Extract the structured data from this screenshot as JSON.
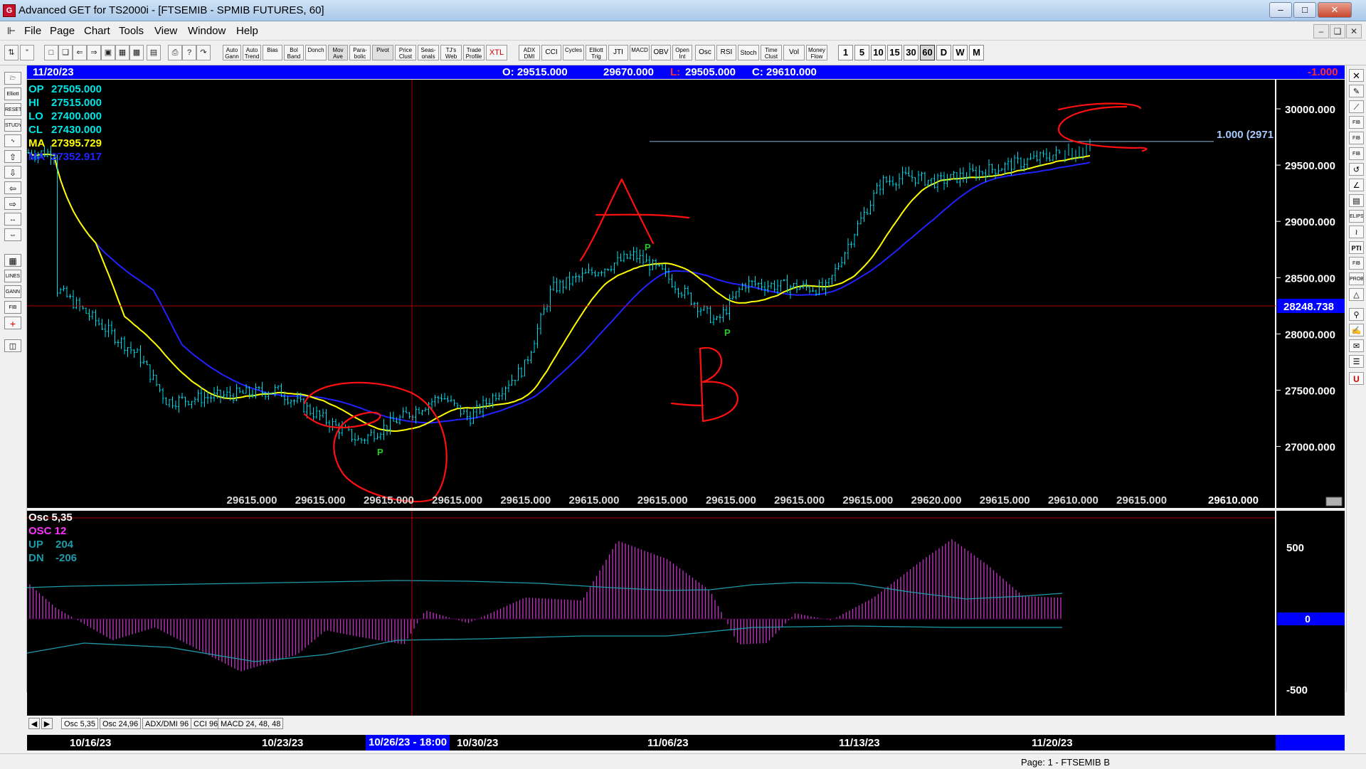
{
  "window": {
    "title": "Advanced GET for TS2000i - [FTSEMIB - SPMIB FUTURES, 60]"
  },
  "menu": [
    "File",
    "Page",
    "Chart",
    "Tools",
    "View",
    "Window",
    "Help"
  ],
  "toolbar": {
    "studies": [
      "Auto Gann",
      "Auto Trend",
      "Bias",
      "Bol Band",
      "Donch",
      "Mov Ave",
      "Para-bolic",
      "Pivot",
      "Price Clust",
      "Seas-onals",
      "TJ's Web",
      "Trade Profile",
      "XTL",
      "ADX DMI",
      "CCI",
      "Cycles",
      "Elliott Trig",
      "JTI",
      "MACD",
      "OBV",
      "Open Int",
      "Osc",
      "RSI",
      "Stoch",
      "Time Clust",
      "Vol",
      "Money Flow"
    ],
    "timeframes": [
      "1",
      "5",
      "10",
      "15",
      "30",
      "60",
      "D",
      "W",
      "M"
    ],
    "active_timeframe": "60"
  },
  "left_tools": [
    "Elliott",
    "RESET",
    "STUDY",
    "LINES",
    "GANN",
    "FIB"
  ],
  "right_tools": [
    "FIB RET",
    "FIB EXT",
    "FIB TIME",
    "ELIPS",
    "PTI",
    "FIB",
    "PROB",
    "U"
  ],
  "info_bar": {
    "date": "11/20/23",
    "open": "O: 29515.000",
    "high": "29670.000",
    "low_label": "L:",
    "low": "29505.000",
    "close": "C: 29610.000",
    "change": "-1.000"
  },
  "legend": [
    {
      "label": "OP",
      "value": "27505.000",
      "color": "#00e5e5"
    },
    {
      "label": "HI",
      "value": "27515.000",
      "color": "#00e5e5"
    },
    {
      "label": "LO",
      "value": "27400.000",
      "color": "#00e5e5"
    },
    {
      "label": "CL",
      "value": "27430.000",
      "color": "#00e5e5"
    },
    {
      "label": "MA",
      "value": "27395.729",
      "color": "#ffff00"
    },
    {
      "label": "MA",
      "value": "27352.917",
      "color": "#2222ff"
    }
  ],
  "price_axis": {
    "ticks": [
      30000,
      29500,
      29000,
      28500,
      28000,
      27500,
      27000
    ],
    "tick_labels": [
      "30000.000",
      "29500.000",
      "29000.000",
      "28500.000",
      "28000.000",
      "27500.000",
      "27000.000"
    ],
    "crosshair_value": 28248.738,
    "crosshair_label": "28248.738"
  },
  "fib_line": {
    "label": "1.000 (2971",
    "value": 29710
  },
  "bottom_values": [
    "29615.000",
    "29615.000",
    "29615.000",
    "29615.000",
    "29615.000",
    "29615.000",
    "29615.000",
    "29615.000",
    "29615.000",
    "29615.000",
    "29620.000",
    "29615.000",
    "29610.000",
    "29615.000"
  ],
  "bottom_last": "29610.000",
  "pivots": [
    "P",
    "P",
    "P"
  ],
  "annotations": [
    "A",
    "B",
    "C"
  ],
  "osc": {
    "header": "Osc 5,35",
    "line1": "OSC 12",
    "up_label": "UP",
    "up_value": "204",
    "dn_label": "DN",
    "dn_value": "-206",
    "axis_labels": [
      "500",
      "0",
      "-500"
    ],
    "colors": {
      "osc": "#cc33cc",
      "band": "#1e9aa8"
    }
  },
  "osc_tabs": [
    "Osc 5,35",
    "Osc 24,96",
    "ADX/DMI 96",
    "CCI 96",
    "MACD 24, 48, 48"
  ],
  "date_axis": {
    "labels": [
      "10/16/23",
      "10/23/23",
      "10/30/23",
      "11/06/23",
      "11/13/23",
      "11/20/23"
    ],
    "cursor_label": "10/26/23 - 18:00"
  },
  "status": {
    "page": "Page: 1 - FTSEMIB B"
  },
  "chart_data": {
    "type": "candlestick",
    "title": "FTSEMIB - SPMIB FUTURES, 60",
    "x": [
      "10/16/23",
      "10/23/23",
      "10/30/23",
      "11/06/23",
      "11/13/23",
      "11/20/23"
    ],
    "ylim": [
      26500,
      30300
    ],
    "approx_closes": [
      {
        "date": "10/16/23",
        "value": 28400
      },
      {
        "date": "10/19/23",
        "value": 27800
      },
      {
        "date": "10/20/23",
        "value": 27400
      },
      {
        "date": "10/24/23",
        "value": 27500
      },
      {
        "date": "10/26/23",
        "value": 27200
      },
      {
        "date": "10/27/23",
        "value": 27050
      },
      {
        "date": "10/30/23",
        "value": 27450
      },
      {
        "date": "10/31/23",
        "value": 27250
      },
      {
        "date": "11/02/23",
        "value": 27700
      },
      {
        "date": "11/03/23",
        "value": 28400
      },
      {
        "date": "11/06/23",
        "value": 28700
      },
      {
        "date": "11/07/23",
        "value": 28550
      },
      {
        "date": "11/09/23",
        "value": 28100
      },
      {
        "date": "11/10/23",
        "value": 28450
      },
      {
        "date": "11/13/23",
        "value": 28400
      },
      {
        "date": "11/14/23",
        "value": 28900
      },
      {
        "date": "11/15/23",
        "value": 29350
      },
      {
        "date": "11/16/23",
        "value": 29400
      },
      {
        "date": "11/17/23",
        "value": 29350
      },
      {
        "date": "11/20/23",
        "value": 29610
      }
    ],
    "series": [
      {
        "name": "MA",
        "color": "#ffff00"
      },
      {
        "name": "MA",
        "color": "#2222ff"
      }
    ]
  }
}
